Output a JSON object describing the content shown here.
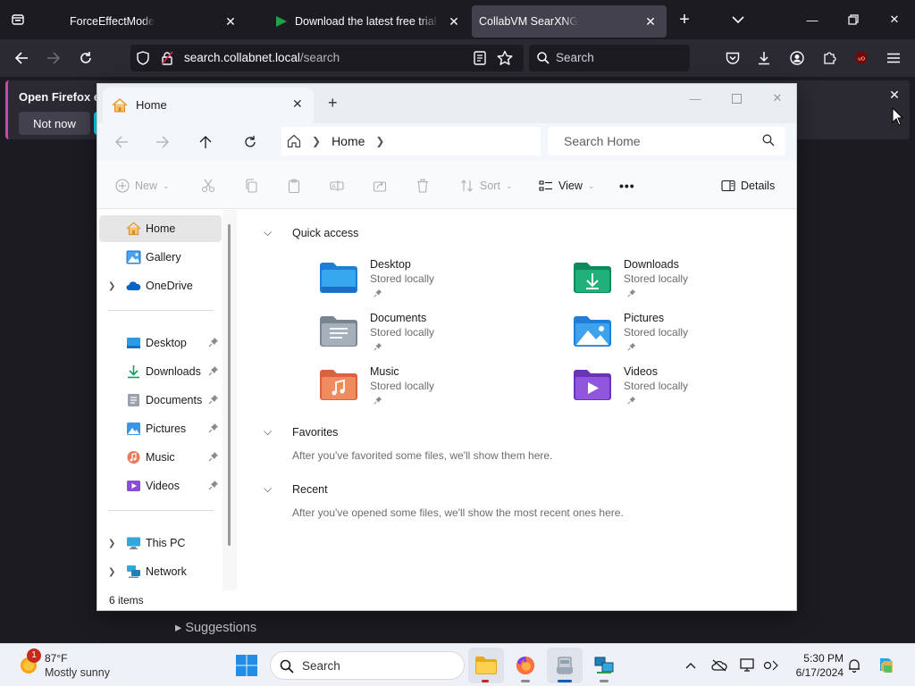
{
  "browser": {
    "tabs": [
      {
        "title": "ForceEffectMode",
        "active": false
      },
      {
        "title": "Download the latest free trial version",
        "active": false
      },
      {
        "title": "CollabVM SearXNG",
        "active": true
      }
    ],
    "url": {
      "host": "search.collabnet.local",
      "path": "/search"
    },
    "search_placeholder": "Search",
    "notice": {
      "title": "Open Firefox ev",
      "dismiss_label": "Not now"
    },
    "page": {
      "suggestions": "Suggestions"
    }
  },
  "explorer": {
    "tab_title": "Home",
    "breadcrumb": {
      "current": "Home"
    },
    "search_placeholder": "Search Home",
    "toolbar": {
      "new_label": "New",
      "sort_label": "Sort",
      "view_label": "View",
      "more_label": "•••",
      "details_label": "Details"
    },
    "nav": {
      "top": [
        {
          "label": "Home",
          "icon": "home-icon",
          "selected": true,
          "expandable": false
        },
        {
          "label": "Gallery",
          "icon": "gallery-icon",
          "selected": false,
          "expandable": false
        },
        {
          "label": "OneDrive",
          "icon": "onedrive-icon",
          "selected": false,
          "expandable": true
        }
      ],
      "pinned": [
        {
          "label": "Desktop",
          "icon": "desktop-folder-icon"
        },
        {
          "label": "Downloads",
          "icon": "download-arrow-icon"
        },
        {
          "label": "Documents",
          "icon": "documents-folder-icon"
        },
        {
          "label": "Pictures",
          "icon": "pictures-folder-icon"
        },
        {
          "label": "Music",
          "icon": "music-folder-icon"
        },
        {
          "label": "Videos",
          "icon": "videos-folder-icon"
        }
      ],
      "bottom": [
        {
          "label": "This PC",
          "icon": "this-pc-icon"
        },
        {
          "label": "Network",
          "icon": "network-icon"
        }
      ]
    },
    "quick_access": {
      "title": "Quick access",
      "items": [
        {
          "name": "Desktop",
          "sub": "Stored locally",
          "icon": "desktop-folder-icon"
        },
        {
          "name": "Downloads",
          "sub": "Stored locally",
          "icon": "downloads-folder-icon"
        },
        {
          "name": "Documents",
          "sub": "Stored locally",
          "icon": "documents-folder-icon"
        },
        {
          "name": "Pictures",
          "sub": "Stored locally",
          "icon": "pictures-folder-icon"
        },
        {
          "name": "Music",
          "sub": "Stored locally",
          "icon": "music-folder-icon"
        },
        {
          "name": "Videos",
          "sub": "Stored locally",
          "icon": "videos-folder-icon"
        }
      ]
    },
    "favorites": {
      "title": "Favorites",
      "empty": "After you've favorited some files, we'll show them here."
    },
    "recent": {
      "title": "Recent",
      "empty": "After you've opened some files, we'll show the most recent ones here."
    },
    "status": "6 items"
  },
  "taskbar": {
    "weather": {
      "temp": "87°F",
      "desc": "Mostly sunny",
      "badge": "1"
    },
    "search_placeholder": "Search",
    "clock": {
      "time": "5:30 PM",
      "date": "6/17/2024"
    }
  },
  "colors": {
    "accent": "#005fb8",
    "firefox_bg": "#1c1b22",
    "firefox_toolbar": "#2b2a33",
    "explorer_bg": "#ffffff"
  }
}
